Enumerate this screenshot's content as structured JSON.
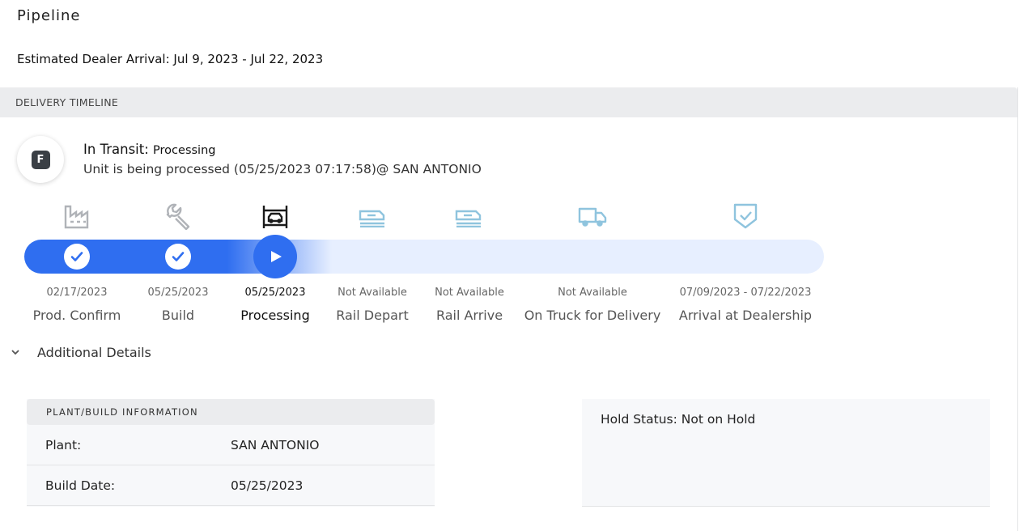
{
  "page": {
    "title": "Pipeline",
    "estimated_arrival": "Estimated Dealer Arrival: Jul 9, 2023 - Jul 22, 2023"
  },
  "timeline": {
    "header": "DELIVERY TIMELINE",
    "avatar_letter": "F",
    "status_prefix": "In Transit:",
    "status_value": "Processing",
    "status_detail": "Unit is being processed (05/25/2023 07:17:58)@ SAN ANTONIO",
    "progress_completed_stages": 2,
    "current_stage_index": 2,
    "stages": [
      {
        "name": "Prod. Confirm",
        "date": "02/17/2023",
        "icon": "factory-icon",
        "state": "complete"
      },
      {
        "name": "Build",
        "date": "05/25/2023",
        "icon": "wrench-icon",
        "state": "complete"
      },
      {
        "name": "Processing",
        "date": "05/25/2023",
        "icon": "vehicle-processing-icon",
        "state": "current"
      },
      {
        "name": "Rail Depart",
        "date": "Not Available",
        "icon": "rail-car-icon",
        "state": "pending"
      },
      {
        "name": "Rail Arrive",
        "date": "Not Available",
        "icon": "rail-car-icon",
        "state": "pending"
      },
      {
        "name": "On Truck for Delivery",
        "date": "Not Available",
        "icon": "truck-icon",
        "state": "pending"
      },
      {
        "name": "Arrival at Dealership",
        "date": "07/09/2023 - 07/22/2023",
        "icon": "shield-check-icon",
        "state": "pending"
      }
    ]
  },
  "details": {
    "toggle_label": "Additional Details",
    "plant_card": {
      "header": "PLANT/BUILD INFORMATION",
      "rows": [
        {
          "label": "Plant:",
          "value": "SAN ANTONIO"
        },
        {
          "label": "Build Date:",
          "value": "05/25/2023"
        }
      ]
    },
    "hold_status": "Hold Status: Not on Hold"
  },
  "colors": {
    "accent": "#2f6ef0",
    "track_bg": "#e7efff",
    "icon_done": "#b0b3b8",
    "icon_current": "#1a1a1a",
    "icon_pending": "#8fc4de"
  }
}
